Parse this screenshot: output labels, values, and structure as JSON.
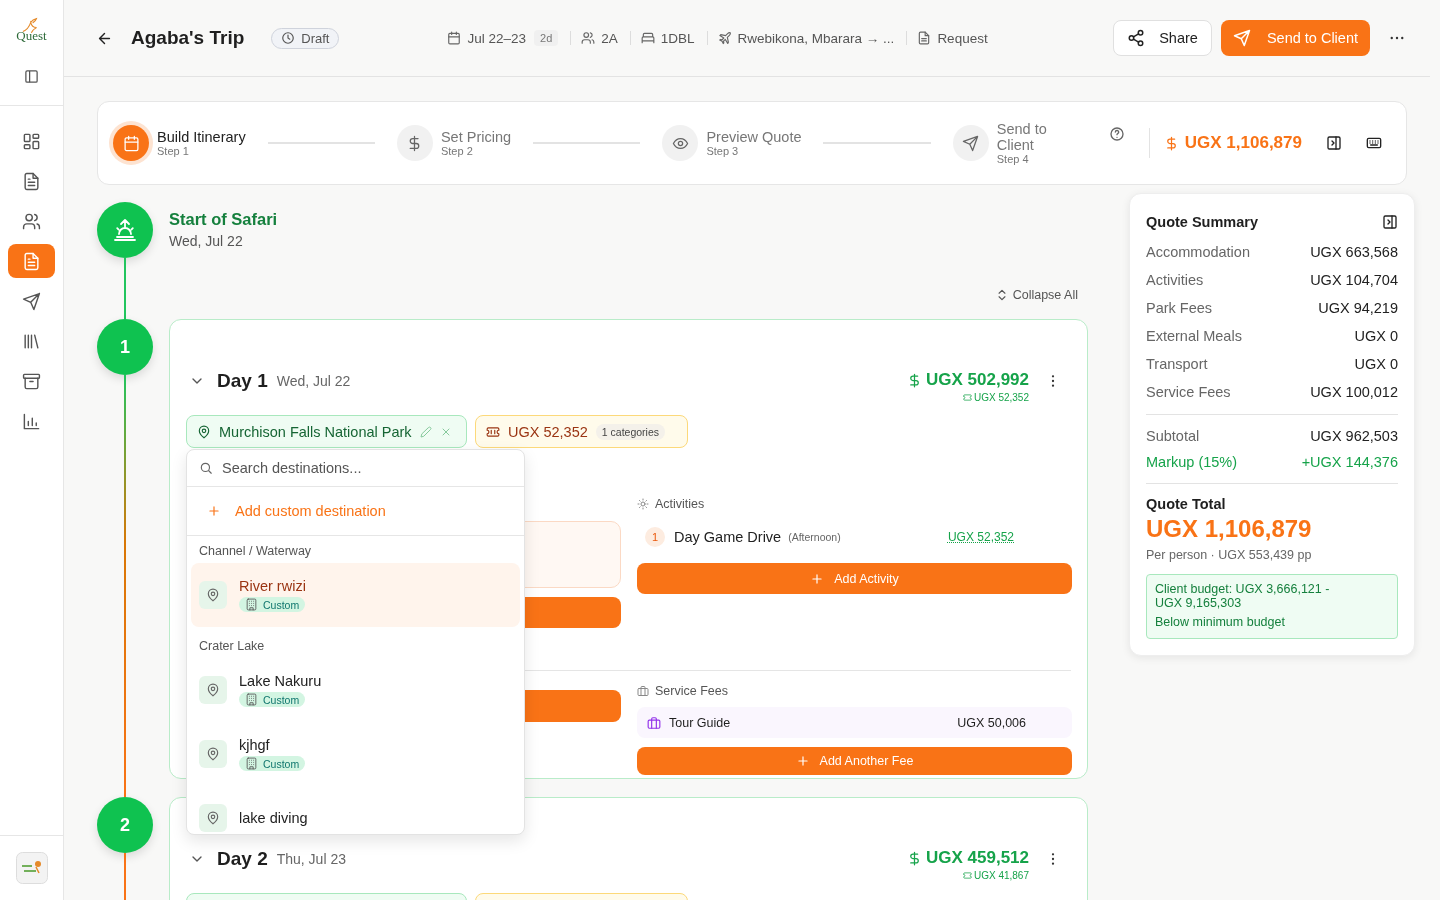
{
  "sidebar": {
    "brand": "Quest",
    "nav": [
      {
        "selected": false
      },
      {
        "selected": false
      },
      {
        "selected": false
      },
      {
        "selected": true
      },
      {
        "selected": false
      },
      {
        "selected": false
      },
      {
        "selected": false
      },
      {
        "selected": false
      }
    ]
  },
  "header": {
    "title": "Agaba's Trip",
    "status": "Draft",
    "dates": "Jul 22–23",
    "duration": "2d",
    "guests": "2A",
    "rooms": "1DBL",
    "route": "Rwebikona, Mbarara → ...",
    "request": "Request",
    "share": "Share",
    "send": "Send to Client"
  },
  "stepper": {
    "steps": [
      {
        "label": "Build Itinerary",
        "step": "Step 1",
        "selected": true
      },
      {
        "label": "Set Pricing",
        "step": "Step 2",
        "selected": false
      },
      {
        "label": "Preview Quote",
        "step": "Step 3",
        "selected": false
      },
      {
        "label": "Send to Client",
        "step": "Step 4",
        "selected": false
      }
    ],
    "total": "UGX 1,106,879"
  },
  "timeline": {
    "start": {
      "title": "Start of Safari",
      "date": "Wed, Jul 22"
    },
    "collapse": "Collapse All",
    "days": [
      {
        "number": "1",
        "label": "Day 1",
        "date": "Wed, Jul 22",
        "total": "UGX 502,992",
        "fees_total": "UGX 52,352",
        "expanded": true,
        "destination": "Murchison Falls National Park",
        "fees": "UGX 52,352",
        "fee_count": "1 categories",
        "activities_title": "Activities",
        "activities": [
          {
            "index": "1",
            "name": "Day Game Drive",
            "time": "(Afternoon)",
            "price": "UGX 52,352"
          }
        ],
        "add_activity": "Add Activity",
        "service_title": "Service Fees",
        "service_fees": [
          {
            "name": "Tour Guide",
            "price": "UGX 50,006"
          }
        ],
        "add_fee": "Add Another Fee"
      },
      {
        "number": "2",
        "label": "Day 2",
        "date": "Thu, Jul 23",
        "total": "UGX 459,512",
        "fees_total": "UGX 41,867",
        "expanded": true
      }
    ]
  },
  "destination_menu": {
    "placeholder": "Search destinations...",
    "add": "Add custom destination",
    "groups": [
      {
        "title": "Channel / Waterway",
        "items": [
          {
            "name": "River rwizi",
            "tag": "Custom",
            "selected": true
          }
        ]
      },
      {
        "title": "Crater Lake",
        "items": [
          {
            "name": "Lake Nakuru",
            "tag": "Custom",
            "selected": false
          },
          {
            "name": "kjhgf",
            "tag": "Custom",
            "selected": false
          },
          {
            "name": "lake diving",
            "selected": false
          }
        ]
      }
    ]
  },
  "summary": {
    "title": "Quote Summary",
    "rows": [
      {
        "label": "Accommodation",
        "value": "UGX 663,568"
      },
      {
        "label": "Activities",
        "value": "UGX 104,704"
      },
      {
        "label": "Park Fees",
        "value": "UGX 94,219"
      },
      {
        "label": "External Meals",
        "value": "UGX 0"
      },
      {
        "label": "Transport",
        "value": "UGX 0"
      },
      {
        "label": "Service Fees",
        "value": "UGX 100,012"
      }
    ],
    "subtotal": {
      "label": "Subtotal",
      "value": "UGX 962,503"
    },
    "markup": {
      "label": "Markup (15%)",
      "value": "+UGX 144,376"
    },
    "total_label": "Quote Total",
    "total": "UGX 1,106,879",
    "per_person": "Per person · UGX 553,439 pp",
    "budget": {
      "range": "Client budget: UGX 3,666,121 - UGX 9,165,303",
      "status": "Below minimum budget"
    }
  }
}
